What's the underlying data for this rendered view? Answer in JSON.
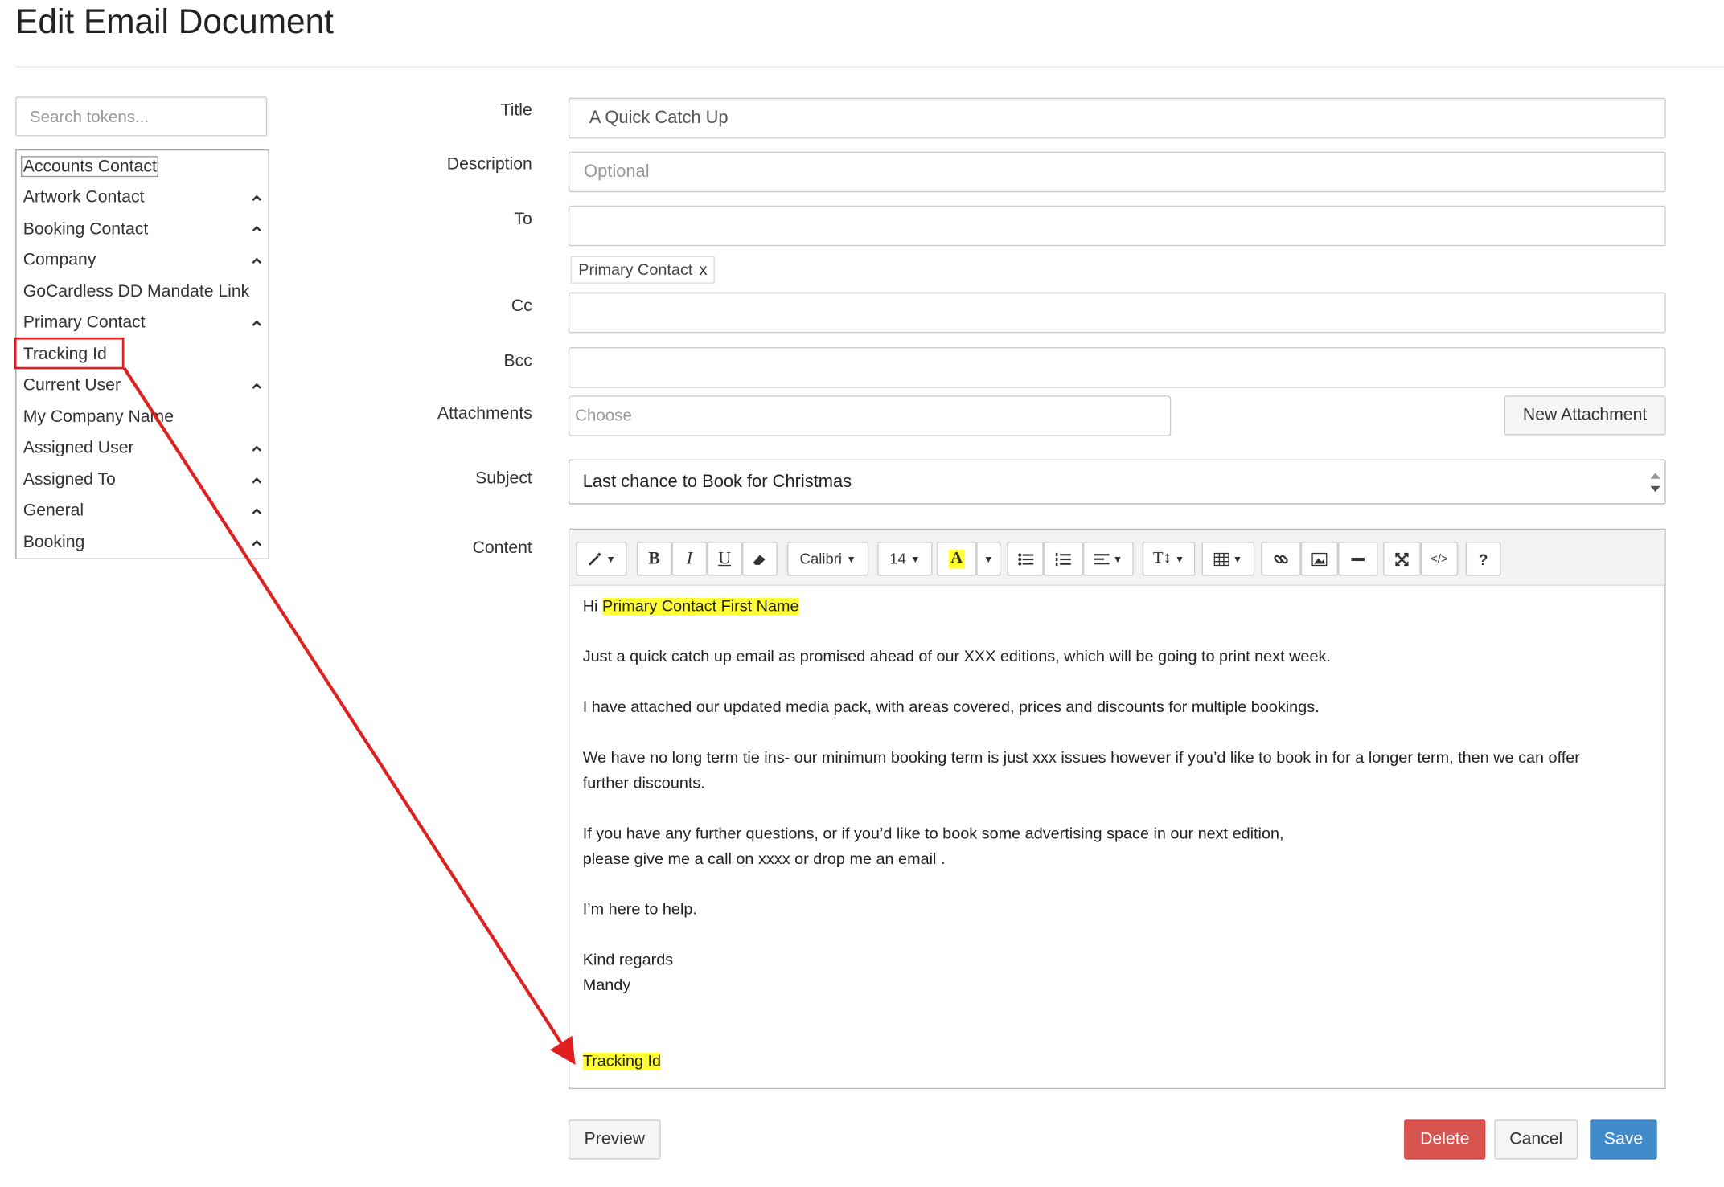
{
  "page": {
    "title": "Edit Email Document"
  },
  "tokens": {
    "search_placeholder": "Search tokens...",
    "items": [
      {
        "label": "Accounts Contact",
        "expandable": false,
        "selected": true
      },
      {
        "label": "Artwork Contact",
        "expandable": true
      },
      {
        "label": "Booking Contact",
        "expandable": true
      },
      {
        "label": "Company",
        "expandable": true
      },
      {
        "label": "GoCardless DD Mandate Link",
        "expandable": false
      },
      {
        "label": "Primary Contact",
        "expandable": true
      },
      {
        "label": "Tracking Id",
        "expandable": false,
        "highlighted": true
      },
      {
        "label": "Current User",
        "expandable": true
      },
      {
        "label": "My Company Name",
        "expandable": false
      },
      {
        "label": "Assigned User",
        "expandable": true
      },
      {
        "label": "Assigned To",
        "expandable": true
      },
      {
        "label": "General",
        "expandable": true
      },
      {
        "label": "Booking",
        "expandable": true
      }
    ]
  },
  "form": {
    "title_label": "Title",
    "title_value": "A Quick Catch Up",
    "description_label": "Description",
    "description_placeholder": "Optional",
    "to_label": "To",
    "to_value": "",
    "to_chip": "Primary Contact",
    "to_chip_remove": "x",
    "cc_label": "Cc",
    "bcc_label": "Bcc",
    "attachments_label": "Attachments",
    "attachments_placeholder": "Choose",
    "new_attachment_button": "New Attachment",
    "subject_label": "Subject",
    "subject_value": "Last chance to Book for Christmas",
    "content_label": "Content"
  },
  "toolbar": {
    "font_name": "Calibri",
    "font_size": "14",
    "bold": "B",
    "italic": "I",
    "underline": "U",
    "color_letter": "A",
    "help": "?"
  },
  "content": {
    "greeting_prefix": "Hi ",
    "greeting_token": "Primary Contact First Name",
    "p1": "Just a quick catch up email as promised ahead of our XXX editions, which will be going to print next week.",
    "p2": "I have attached our updated media pack, with areas covered, prices and discounts for multiple bookings.",
    "p3a": "We have no long term tie ins- our minimum booking term is just xxx issues however if you’d like to book in for a longer term, then we can offer",
    "p3b": "further discounts.",
    "p4a": "If you have any further questions, or if you’d like to book some advertising space in our next edition,",
    "p4b": "please give me a call on xxxx or drop me an email .",
    "p5": "I’m here to help.",
    "sign1": "Kind regards",
    "sign2": "Mandy",
    "tracking_token": "Tracking Id"
  },
  "actions": {
    "preview": "Preview",
    "delete": "Delete",
    "cancel": "Cancel",
    "save": "Save"
  },
  "colors": {
    "delete": "#d9534f",
    "save": "#428bca",
    "annotation": "#e02020",
    "token_highlight": "#ffff33"
  }
}
